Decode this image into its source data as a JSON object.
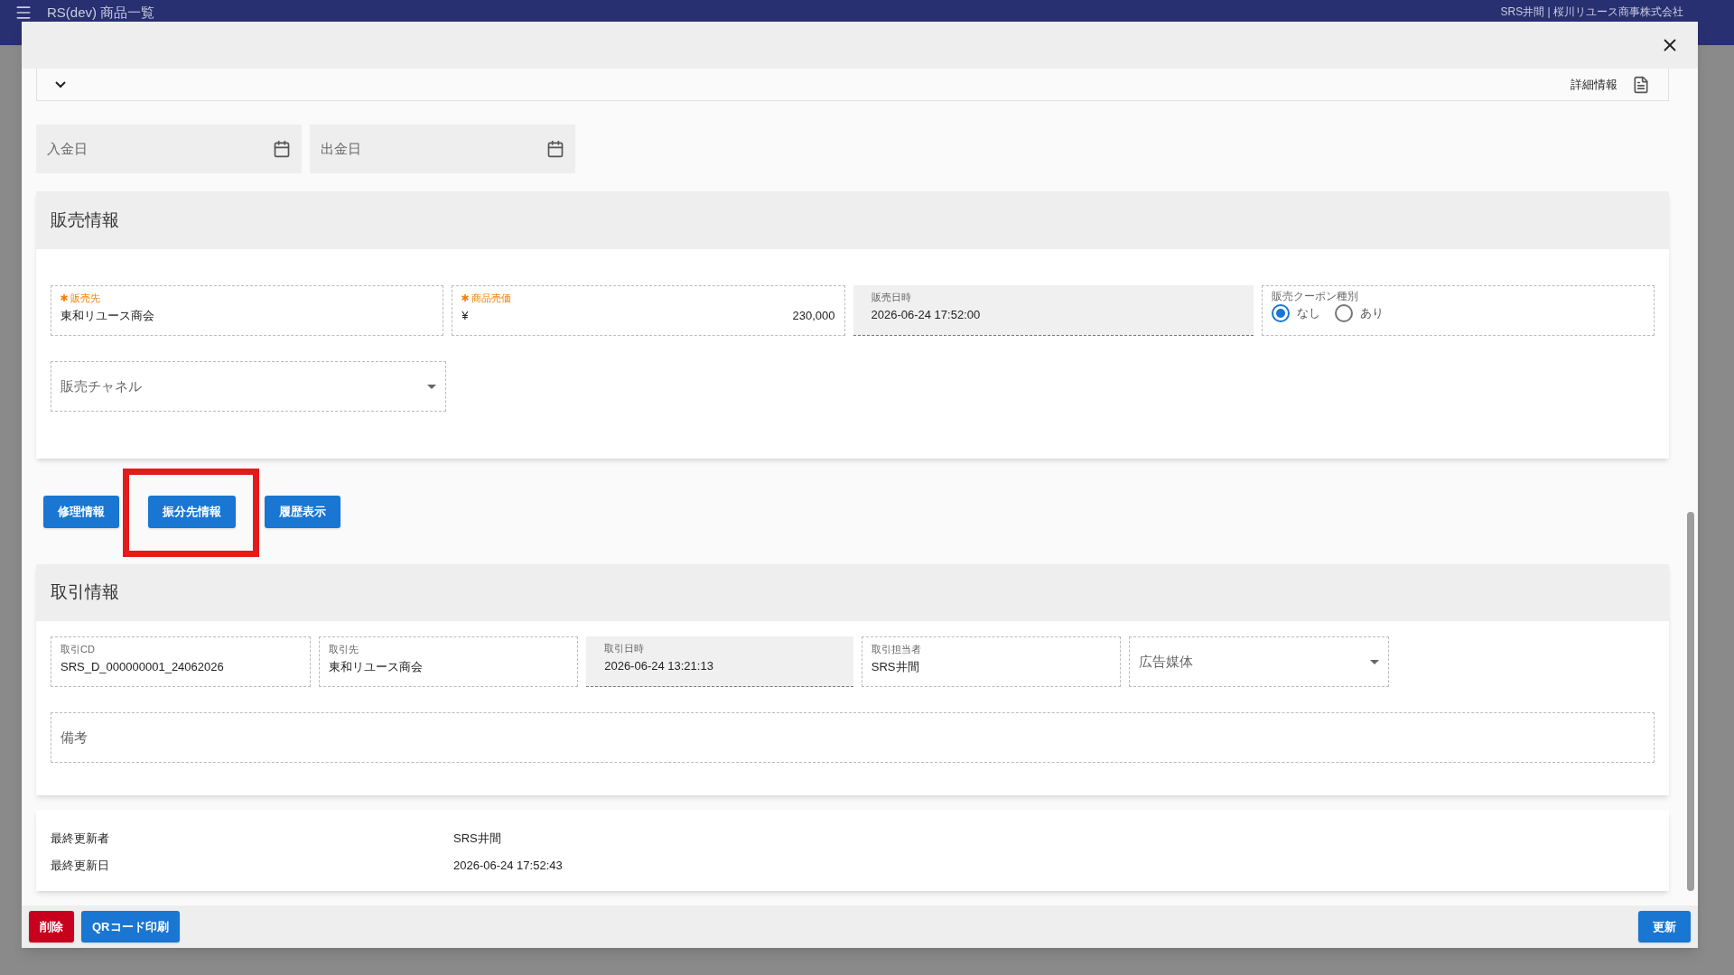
{
  "app_bar": {
    "title": "RS(dev) 商品一覧",
    "user": "SRS井間 | 桜川リユース商事株式会社"
  },
  "detail_bar": {
    "label": "詳細情報",
    "expanded": false
  },
  "date_fields": [
    {
      "placeholder": "入金日"
    },
    {
      "placeholder": "出金日"
    }
  ],
  "sales": {
    "title": "販売情報",
    "fields": [
      {
        "kind": "text",
        "label": "販売先",
        "required": true,
        "value": "東和リユース商会"
      },
      {
        "kind": "price",
        "label": "商品売価",
        "required": true,
        "prefix": "¥",
        "value": "230,000"
      },
      {
        "kind": "readonly",
        "label": "販売日時",
        "required": false,
        "value": "2026-06-24 17:52:00"
      },
      {
        "kind": "radio",
        "label": "販売クーポン種別",
        "options": [
          {
            "label": "なし",
            "selected": true
          },
          {
            "label": "あり",
            "selected": false
          }
        ]
      }
    ],
    "channel": {
      "placeholder": "販売チャネル"
    }
  },
  "action_buttons": [
    {
      "label": "修理情報",
      "highlighted": false
    },
    {
      "label": "振分先情報",
      "highlighted": true
    },
    {
      "label": "履歴表示",
      "highlighted": false
    }
  ],
  "trade": {
    "title": "取引情報",
    "fields": [
      {
        "kind": "text",
        "label": "取引CD",
        "value": "SRS_D_000000001_24062026"
      },
      {
        "kind": "text",
        "label": "取引先",
        "value": "東和リユース商会"
      },
      {
        "kind": "readonly",
        "label": "取引日時",
        "value": "2026-06-24 13:21:13"
      },
      {
        "kind": "text",
        "label": "取引担当者",
        "value": "SRS井間"
      },
      {
        "kind": "select",
        "placeholder": "広告媒体"
      }
    ],
    "notes": {
      "placeholder": "備考"
    }
  },
  "meta": [
    {
      "label": "最終更新者",
      "value": "SRS井間"
    },
    {
      "label": "最終更新日",
      "value": "2026-06-24 17:52:43"
    }
  ],
  "footer": {
    "left_buttons": [
      {
        "label": "削除",
        "kind": "danger"
      },
      {
        "label": "QRコード印刷",
        "kind": "primary"
      }
    ],
    "right_button": {
      "label": "更新"
    }
  }
}
